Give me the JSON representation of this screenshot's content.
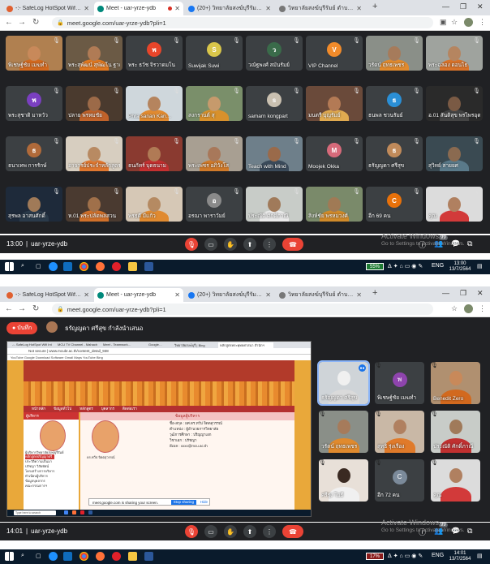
{
  "top": {
    "tabs": [
      {
        "title": "-:- SafeLog HotSpot Wifi Internet -:-",
        "color": "#e06030"
      },
      {
        "title": "Meet - uar-yrze-ydb",
        "color": "#00897b"
      },
      {
        "title": "(20+) วิทยาลัยสงฆ์บุรีรัมย์ มจร. | Face",
        "color": "#1877f2"
      },
      {
        "title": "วิทยาลัยสงฆ์บุรีรัมย์ ตำบลหลักเมือง",
        "color": "#777777"
      }
    ],
    "url": "meet.google.com/uar-yrze-ydb?pli=1",
    "tiles": [
      {
        "name": "พิเชษฐ์ชัย เมฆทำ",
        "kind": "person",
        "bg": "#b08050",
        "head": "#c8895a",
        "body": "#d2691e"
      },
      {
        "name": "พระสุพัฒน์ สุพัฒโน ฐาณะ",
        "kind": "person",
        "bg": "#6b5a45",
        "head": "#b07b55",
        "body": "#e07820"
      },
      {
        "name": "พระ ธวัช จิรวาดมโน",
        "kind": "avatar",
        "avatar_color": "#e8452a",
        "letter": "พ"
      },
      {
        "name": "Suwijak Suwi",
        "kind": "avatar",
        "avatar_color": "#d9c64a",
        "letter": "S"
      },
      {
        "name": "วณัฐพงศ์ สมันรัมย์",
        "kind": "avatar",
        "avatar_color": "#3a6b4a",
        "letter": "ว"
      },
      {
        "name": "VIP Channel",
        "kind": "avatar",
        "avatar_color": "#f28b2a",
        "letter": "V"
      },
      {
        "name": "วรัตน์ ฤทธเพชร",
        "kind": "person",
        "bg": "#8a8f88",
        "head": "#a67b5b",
        "body": "#e08a2e"
      },
      {
        "name": "พระฉลอง ดอนไธ",
        "kind": "person",
        "bg": "#9fa39e",
        "head": "#b58560",
        "body": "#d8732a"
      },
      {
        "name": "พระสุชาติ มาหวัว",
        "kind": "avatar",
        "avatar_color": "#7a3fc0",
        "letter": "พ"
      },
      {
        "name": "ปลาย พรหมชัย",
        "kind": "person",
        "bg": "#4a3a2e",
        "head": "#9c6a48",
        "body": "#c0622a"
      },
      {
        "name": "Phra sanan Kan…",
        "kind": "person",
        "bg": "#cfd7dc",
        "head": "#b5845e",
        "body": "#e08a30"
      },
      {
        "name": "สงกรานต์ สุ",
        "kind": "person",
        "bg": "#7a8f6a",
        "head": "#c69a6c",
        "body": "#d8912c"
      },
      {
        "name": "samarn kongpart",
        "kind": "avatar",
        "avatar_color": "#c9c0b0",
        "letter": "s"
      },
      {
        "name": "มนตรี บุญรัมย์",
        "kind": "person",
        "bg": "#6a4a3a",
        "head": "#b37a55",
        "body": "#e0aa50"
      },
      {
        "name": "ธนพล ชวนรัมย์",
        "kind": "avatar",
        "avatar_color": "#2a8fd6",
        "letter": "ธ"
      },
      {
        "name": "อ.01 สันติสุข พรไพรอุดม",
        "kind": "person",
        "bg": "#2a2a2a",
        "head": "#7a5a44",
        "body": "#444444"
      },
      {
        "name": "ธนาเทพ การรักษ์",
        "kind": "avatar",
        "avatar_color": "#b06a3a",
        "letter": "ธ"
      },
      {
        "name": "อาจารย์ประจำหลักสูตร",
        "kind": "person",
        "bg": "#d7cec0",
        "head": "#b88a62",
        "body": "#e07830"
      },
      {
        "name": "ธนภัทร์ บุดธนาม",
        "kind": "person",
        "bg": "#8a3a30",
        "head": "#b07a55",
        "body": "#c43030"
      },
      {
        "name": "พระเพชร อภิวังโส",
        "kind": "person",
        "bg": "#a89f92",
        "head": "#a8785a",
        "body": "#d07a2a"
      },
      {
        "name": "Teach with Mind",
        "kind": "person",
        "bg": "#6e7f8a",
        "head": "#9a6a4a",
        "body": "#3a4a5a"
      },
      {
        "name": "Moojek Okka",
        "kind": "avatar",
        "avatar_color": "#d66a7a",
        "letter": "M"
      },
      {
        "name": "ธรัญญดา ศรีสุข",
        "kind": "avatar",
        "avatar_color": "#c08a5a",
        "letter": "ธ"
      },
      {
        "name": "สุวิทย์ สายยศ",
        "kind": "person",
        "bg": "#3a4a52",
        "head": "#8a6a50",
        "body": "#5a7a8a"
      },
      {
        "name": "สุรพล อาสนศักดิ์",
        "kind": "person",
        "bg": "#1e2a3a",
        "head": "#a07a58",
        "body": "#2a3a4a"
      },
      {
        "name": "ห.01 พระปลัดพลสวน",
        "kind": "person",
        "bg": "#4a3a30",
        "head": "#a0704a",
        "body": "#d0702a"
      },
      {
        "name": "พรธดี มีแก้ว",
        "kind": "person",
        "bg": "#d6c8b6",
        "head": "#b58a62",
        "body": "#e08a30"
      },
      {
        "name": "อรณา พาราวัมย์",
        "kind": "avatar",
        "avatar_color": "#8a8a8a",
        "letter": "อ"
      },
      {
        "name": "ประณัติ ศักดิ์ภาณี",
        "kind": "person",
        "bg": "#c8ccc8",
        "head": "#a07a5a",
        "body": "#eaeaea"
      },
      {
        "name": "สิงห์ชัย พรหมวงศ์",
        "kind": "person",
        "bg": "#7a8a6a",
        "head": "#a07a55",
        "body": "#d08a2a"
      },
      {
        "name": "อีก 69 คน",
        "kind": "more",
        "avatar_color": "#e8710a",
        "letter": "C"
      },
      {
        "name": "คุณ",
        "kind": "person",
        "bg": "#dcdcdc",
        "head": "#b08060",
        "body": "#d23a3a"
      }
    ],
    "time": "13:00",
    "meeting_code": "uar-yrze-ydb",
    "activate_title": "Activate Windows",
    "activate_sub": "Go to Settings to activate Windows.",
    "count_badge": "99",
    "battery": "55%",
    "lang": "ENG",
    "clock_time": "13:00",
    "clock_date": "13/7/2564"
  },
  "bottom": {
    "tabs": [
      {
        "title": "-:- SafeLog HotSpot Wifi Internet -:-",
        "color": "#e06030"
      },
      {
        "title": "Meet - uar-yrze-ydb",
        "color": "#00897b"
      },
      {
        "title": "(20+) วิทยาลัยสงฆ์บุรีรัมย์ มจร. | Face",
        "color": "#1877f2"
      },
      {
        "title": "วิทยาลัยสงฆ์บุรีรัมย์ ตำบลหลักเมือง",
        "color": "#777777"
      }
    ],
    "url": "meet.google.com/uar-yrze-ydb?pli=1",
    "record_label": "บันทึก",
    "presenting_text": "ธรัญญดา ศรีสุข กำลังนำเสนอ",
    "shared": {
      "inner_tabs": [
        "-:- SafeLog HotSpot Wifi Int",
        "MCU TV Channel - Mahach",
        "Meet - Teamwork…",
        "Google…",
        "วิทยาลัยสงฆ์บุรี | Bing",
        "หลักสูตรพระพุทธศาสนา สำนักฯ"
      ],
      "inner_url": "Not secure | www.mcubr.ac.th/content_detail_938",
      "bookmarks": "YouTube   Google   Download Software   Gmail   Maps   YouTube   Bing",
      "menu": [
        "หน้าหลัก",
        "ข้อมูลทั่วไป",
        "หลักสูตร",
        "บุคลากร",
        "ติดต่อเรา"
      ],
      "side_header": "ผู้บริหาร",
      "side_name": "ผู้บริหารวิทยาลัยสงฆ์บุรีรัมย์",
      "side_links": [
        "หลักสูตรปริญญาตรี",
        "ประวัติความเป็นมา",
        "ปรัชญา วิสัยทัศน์",
        "โครงสร้างการบริหาร",
        "ทำเนียบผู้บริหาร",
        "ข้อมูลบุคลากร",
        "คณะกรรมการฯ"
      ],
      "main_header": "ข้อมูลผู้บริหาร",
      "main_caption": "ดร.ทวีป จิตตสุวรรณ์",
      "info": [
        "ชื่อ-สกุล : ผศ.ดร.ทวีป จิตตสุวรรณ์",
        "ตำแหน่ง : ผู้อำนวยการวิทยาลัย",
        "วุฒิการศึกษา : ปริญญาเอก",
        "วิชาเอก : ปรัชญา",
        "อีเมล : xxxx@mcu.ac.th"
      ],
      "share_text": "meet.google.com is sharing your screen.",
      "stop_label": "Stop sharing",
      "hide_label": "Hide",
      "search_placeholder": "Type here to search"
    },
    "tiles": [
      {
        "name": "ธรัญญดา ศรีสุข",
        "kind": "person",
        "bg": "#cfd4d8",
        "head": "#f0f0f0",
        "body": "#dadada",
        "speaking": true
      },
      {
        "name": "พิเชษฐ์ชัย เมฆทำ",
        "kind": "avatar",
        "avatar_color": "#8e44ad",
        "letter": "พ"
      },
      {
        "name": "Benedit Zero",
        "kind": "person",
        "bg": "#b09070",
        "head": "#c8895a",
        "body": "#d2691e"
      },
      {
        "name": "วรัตน์ ฤทธเพชร",
        "kind": "person",
        "bg": "#8a8f88",
        "head": "#a67b5b",
        "body": "#e08a2e"
      },
      {
        "name": "สุทธิ รุ่งเรือง",
        "kind": "person",
        "bg": "#c9b8a6",
        "head": "#b08060",
        "body": "#e07a2a"
      },
      {
        "name": "ประณัติ ศักดิ์ภาณี",
        "kind": "person",
        "bg": "#c8ccc8",
        "head": "#a07a5a",
        "body": "#c03030"
      },
      {
        "name": "ศรีรุ่ง โยธี",
        "kind": "person",
        "bg": "#e8e0d8",
        "head": "#3a2a22",
        "body": "#f0f0f0"
      },
      {
        "name": "อีก 72 คน",
        "kind": "more",
        "avatar_color": "#7b8a9a",
        "letter": "C"
      },
      {
        "name": "คุณ",
        "kind": "person",
        "bg": "#dcdcdc",
        "head": "#b08060",
        "body": "#d23a3a"
      }
    ],
    "time": "14:01",
    "meeting_code": "uar-yrze-ydb",
    "activate_title": "Activate Windows",
    "activate_sub": "Go to Settings to activate Windows.",
    "count_badge": "99",
    "battery": "17%",
    "lang": "ENG",
    "clock_time": "14:01",
    "clock_date": "13/7/2564"
  }
}
